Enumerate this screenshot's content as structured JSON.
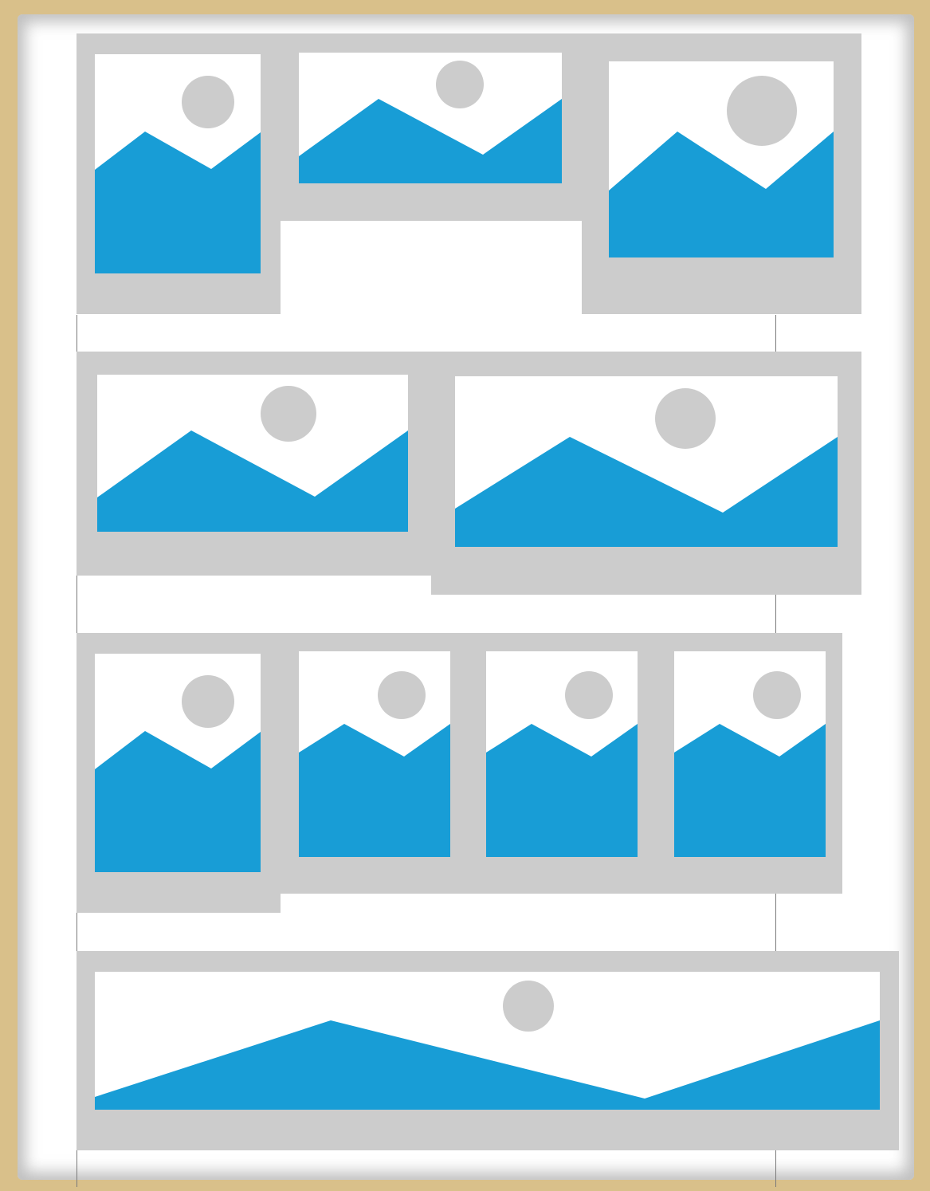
{
  "colors": {
    "background": "#d9c08a",
    "paper": "#ffffff",
    "frame": "#cccccc",
    "mountain": "#189dd6",
    "sun": "#cccccc",
    "guide_line": "#7a7a7a"
  },
  "icons": {
    "placeholder": "image-placeholder-icon",
    "mountain": "mountain-shape",
    "sun": "sun-circle"
  },
  "rows": [
    {
      "name": "row-1",
      "photo_count": 3
    },
    {
      "name": "row-2",
      "photo_count": 2
    },
    {
      "name": "row-3",
      "photo_count": 4
    },
    {
      "name": "row-4",
      "photo_count": 1
    }
  ]
}
